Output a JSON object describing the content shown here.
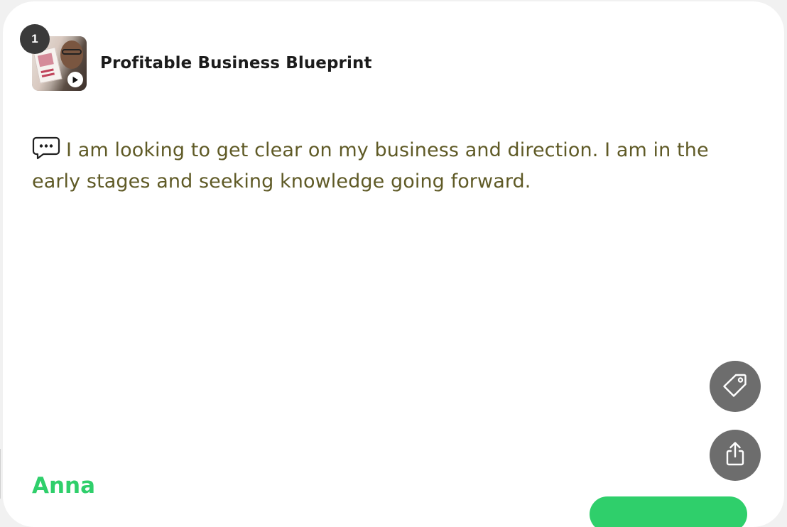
{
  "header": {
    "count_badge": "1",
    "title": "Profitable Business Blueprint"
  },
  "message": {
    "text": "I am looking to get clear on my business and direction.  I am in the early stages and seeking knowledge going forward."
  },
  "author": {
    "name": "Anna"
  },
  "icons": {
    "chat": "speech-bubble-ellipsis-icon",
    "play": "play-icon",
    "tag": "tag-icon",
    "share": "share-icon"
  },
  "colors": {
    "message_text": "#5f5a26",
    "author_accent": "#2fcf6b",
    "fab_background": "#6d6d6d",
    "badge_background": "#3a3a3a"
  }
}
